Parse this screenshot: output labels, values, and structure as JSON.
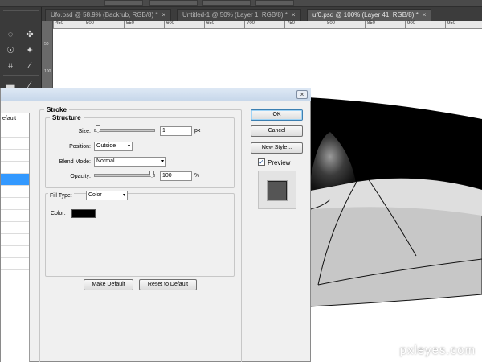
{
  "tabs": [
    {
      "label": "Ufo.psd @ 58.9% (Backrub, RGB/8) *",
      "active": false
    },
    {
      "label": "Untitled-1 @ 50% (Layer 1, RGB/8) *",
      "active": false
    },
    {
      "label": "uf0.psd @ 100% (Layer 41, RGB/8) *",
      "active": true
    }
  ],
  "tab_close": "×",
  "ruler_ticks": [
    "450",
    "500",
    "550",
    "600",
    "650",
    "700",
    "750",
    "800",
    "850",
    "900",
    "950"
  ],
  "vertical_strip_labels": [
    "50",
    "100"
  ],
  "dialog": {
    "style_list": {
      "header": "efault"
    },
    "stroke": {
      "title": "Stroke",
      "structure": {
        "title": "Structure",
        "size_label": "Size:",
        "size_value": "1",
        "size_unit": "px",
        "position_label": "Position:",
        "position_value": "Outside",
        "blend_mode_label": "Blend Mode:",
        "blend_mode_value": "Normal",
        "opacity_label": "Opacity:",
        "opacity_value": "100",
        "opacity_unit": "%",
        "size_slider_level": 0.01,
        "opacity_slider_level": 1.0
      },
      "fill": {
        "fill_type_label": "Fill Type:",
        "fill_type_value": "Color",
        "color_label": "Color:",
        "color_hex": "#000000"
      },
      "make_default": "Make Default",
      "reset_to_default": "Reset to Default"
    },
    "buttons": {
      "ok": "OK",
      "cancel": "Cancel",
      "new_style": "New Style...",
      "preview_label": "Preview",
      "preview_checked": true
    }
  },
  "watermark": "pxleyes.com",
  "colors": {
    "accent": "#3399ff",
    "preview_swatch": "#555555"
  },
  "icons": {
    "dropdown": "▾",
    "check": "✓",
    "close": "×"
  }
}
